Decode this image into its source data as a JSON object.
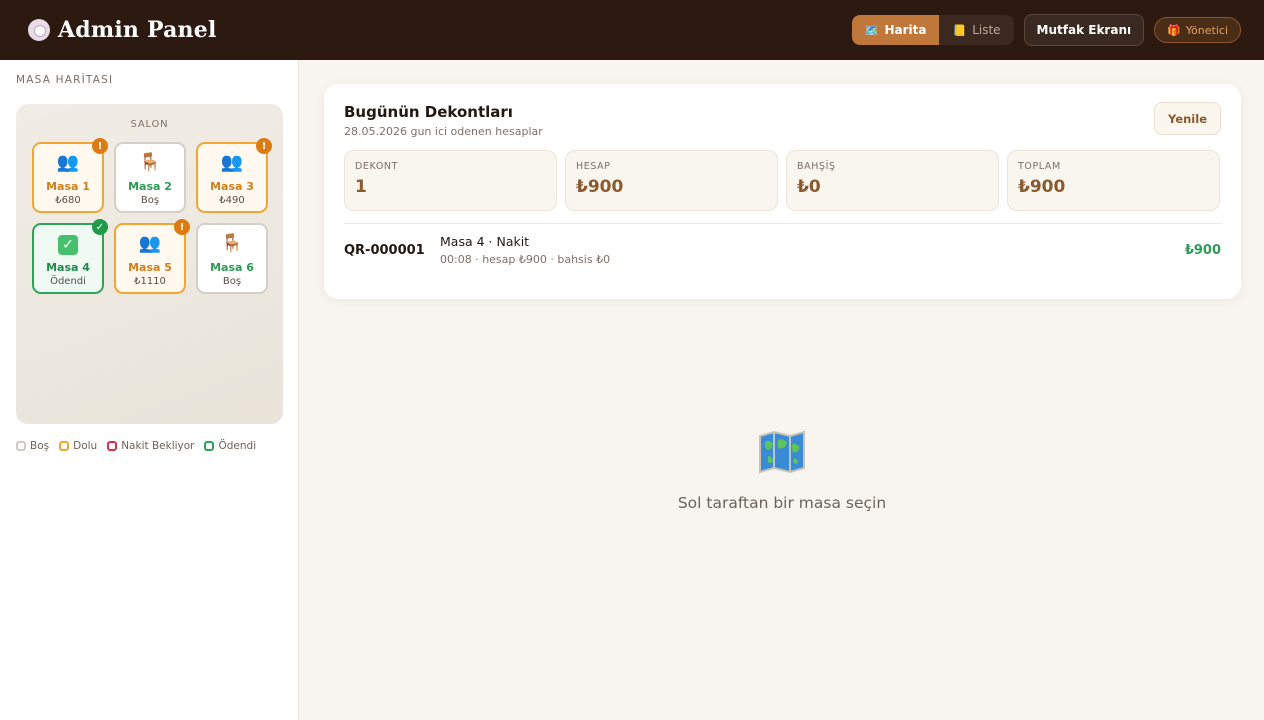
{
  "header": {
    "brand_icon": "plate-icon",
    "title": "Admin Panel",
    "view_toggle": [
      {
        "icon": "map-icon",
        "label": "Harita",
        "active": true
      },
      {
        "icon": "book-icon",
        "label": "Liste",
        "active": false
      }
    ],
    "kitchen_label": "Mutfak Ekranı",
    "manager_label": "Yönetici",
    "manager_icon": "gift-icon"
  },
  "sidebar": {
    "heading": "MASA HARİTASI",
    "area_label": "SALON",
    "tables": [
      {
        "name": "Masa 1",
        "sub": "₺680",
        "status": "dolu",
        "icon": "people-icon",
        "badge": "!"
      },
      {
        "name": "Masa 2",
        "sub": "Boş",
        "status": "bos",
        "icon": "chair-icon",
        "badge": ""
      },
      {
        "name": "Masa 3",
        "sub": "₺490",
        "status": "dolu",
        "icon": "people-icon",
        "badge": "!"
      },
      {
        "name": "Masa 4",
        "sub": "Ödendi",
        "status": "odendi",
        "icon": "check-icon",
        "badge": "✓"
      },
      {
        "name": "Masa 5",
        "sub": "₺1110",
        "status": "dolu",
        "icon": "people-icon",
        "badge": "!"
      },
      {
        "name": "Masa 6",
        "sub": "Boş",
        "status": "bos",
        "icon": "chair-icon",
        "badge": ""
      }
    ],
    "legend": [
      {
        "label": "Boş",
        "color": "#cfcac3"
      },
      {
        "label": "Dolu",
        "color": "#f0a535"
      },
      {
        "label": "Nakit Bekliyor",
        "color": "#d6314a"
      },
      {
        "label": "Ödendi",
        "color": "#2ea357"
      }
    ]
  },
  "receipts": {
    "title": "Bugünün Dekontları",
    "subtitle": "28.05.2026 gun ici odenen hesaplar",
    "refresh_label": "Yenile",
    "stats": [
      {
        "label": "DEKONT",
        "value": "1"
      },
      {
        "label": "HESAP",
        "value": "₺900"
      },
      {
        "label": "BAHŞİŞ",
        "value": "₺0"
      },
      {
        "label": "TOPLAM",
        "value": "₺900"
      }
    ],
    "rows": [
      {
        "code": "QR-000001",
        "title": "Masa 4 · Nakit",
        "detail": "00:08 · hesap ₺900 · bahsis ₺0",
        "amount": "₺900"
      }
    ]
  },
  "empty_state": {
    "icon": "world-map-icon",
    "text": "Sol taraftan bir masa seçin"
  },
  "colors": {
    "header_bg": "#2c1a11",
    "accent": "#c0783a",
    "occupied": "#f0a535",
    "paid": "#2ea357",
    "cash_waiting": "#d6314a"
  }
}
